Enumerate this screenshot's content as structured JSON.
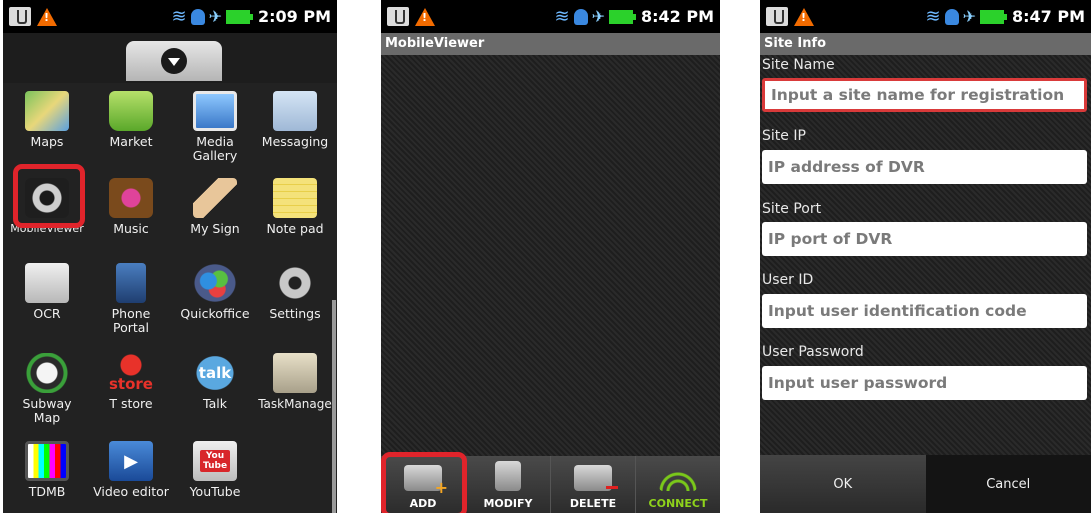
{
  "panel1": {
    "time": "2:09 PM",
    "apps": [
      {
        "label": "Maps"
      },
      {
        "label": "Market"
      },
      {
        "label": "Media\nGallery"
      },
      {
        "label": "Messaging"
      },
      {
        "label": "MobileViewer"
      },
      {
        "label": "Music"
      },
      {
        "label": "My Sign"
      },
      {
        "label": "Note pad"
      },
      {
        "label": "OCR"
      },
      {
        "label": "Phone\nPortal"
      },
      {
        "label": "Quickoffice"
      },
      {
        "label": "Settings"
      },
      {
        "label": "Subway\nMap"
      },
      {
        "label": "T store"
      },
      {
        "label": "Talk"
      },
      {
        "label": "TaskManage"
      },
      {
        "label": "TDMB"
      },
      {
        "label": "Video editor"
      },
      {
        "label": "YouTube"
      }
    ],
    "store_icon_text": "store",
    "talk_icon_text": "talk",
    "youtube_icon_text": "You\nTube"
  },
  "panel2": {
    "time": "8:42 PM",
    "title": "MobileViewer",
    "toolbar": {
      "add": "ADD",
      "modify": "MODIFY",
      "delete": "DELETE",
      "connect": "CONNECT"
    }
  },
  "panel3": {
    "time": "8:47 PM",
    "title": "Site Info",
    "fields": [
      {
        "label": "Site Name",
        "placeholder": "Input a site name for registration"
      },
      {
        "label": "Site IP",
        "placeholder": "IP address of DVR"
      },
      {
        "label": "Site Port",
        "placeholder": "IP port of DVR"
      },
      {
        "label": "User ID",
        "placeholder": "Input user identification code"
      },
      {
        "label": "User Password",
        "placeholder": "Input user password"
      }
    ],
    "buttons": {
      "ok": "OK",
      "cancel": "Cancel"
    }
  },
  "colors": {
    "highlight": "#e0242b",
    "connect": "#8fd31b",
    "focus_border": "#d93a3a"
  }
}
